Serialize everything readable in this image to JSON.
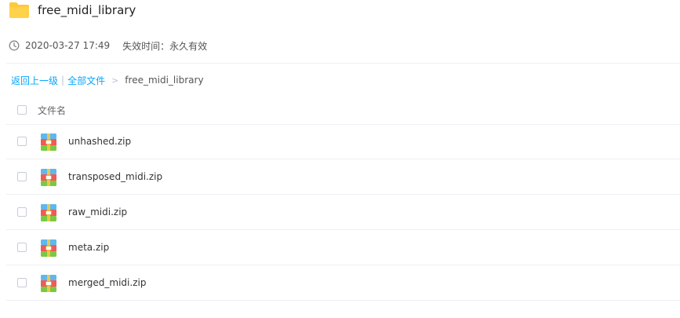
{
  "folder": {
    "title": "free_midi_library"
  },
  "share_info": {
    "created": "2020-03-27 17:49",
    "expiry": "失效时间：永久有效"
  },
  "breadcrumb": {
    "back": "返回上一级",
    "separator": "|",
    "all_files": "全部文件",
    "arrow": ">",
    "current": "free_midi_library"
  },
  "list": {
    "header": "文件名",
    "files": [
      {
        "name": "unhashed.zip",
        "icon": "zip-file-icon"
      },
      {
        "name": "transposed_midi.zip",
        "icon": "zip-file-icon"
      },
      {
        "name": "raw_midi.zip",
        "icon": "zip-file-icon"
      },
      {
        "name": "meta.zip",
        "icon": "zip-file-icon"
      },
      {
        "name": "merged_midi.zip",
        "icon": "zip-file-icon"
      }
    ]
  },
  "colors": {
    "link": "#06a7ff",
    "folder": "#ffd24a",
    "zip_top": "#5db8ef",
    "zip_mid": "#f05b54",
    "zip_bottom": "#7ac943",
    "zip_zipper": "#f7c948"
  }
}
